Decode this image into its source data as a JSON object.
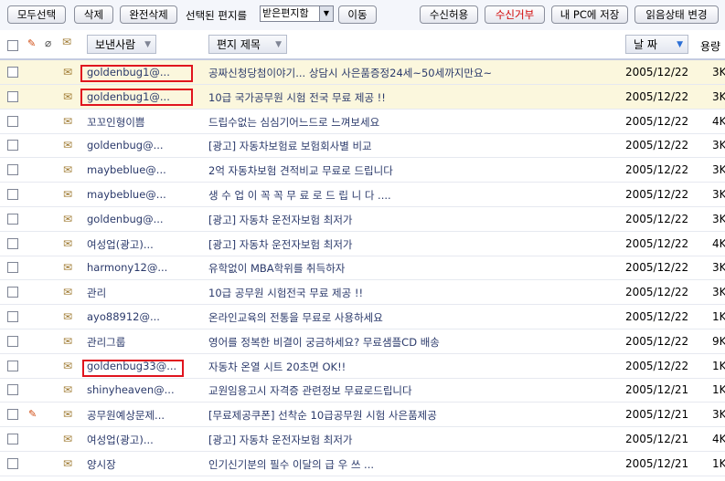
{
  "toolbar": {
    "select_all": "모두선택",
    "delete": "삭제",
    "delete_perm": "완전삭제",
    "move_label": "선택된 편지를",
    "folder": "받은편지함",
    "move": "이동",
    "allow": "수신허용",
    "reject": "수신거부",
    "save_pc": "내 PC에 저장",
    "read_status": "읽음상태 변경"
  },
  "columns": {
    "sender": "보낸사람",
    "subject": "편지 제목",
    "date": "날 짜",
    "size": "용량"
  },
  "rows": [
    {
      "sender": "goldenbug1@...",
      "subject": "공짜신청당첨이야기... 상담시 사은품증정24세~50세까지만요~",
      "date": "2005/12/22",
      "size": "3K"
    },
    {
      "sender": "goldenbug1@...",
      "subject": "10급 국가공무원 시험 전국 무료 제공 !!",
      "date": "2005/12/22",
      "size": "3K"
    },
    {
      "sender": "꼬꼬인형이쁨",
      "subject": "드립수없는 심심기어느드로 느껴보세요",
      "date": "2005/12/22",
      "size": "4K"
    },
    {
      "sender": "goldenbug@...",
      "subject": "[광고] 자동차보험료 보험회사별 비교",
      "date": "2005/12/22",
      "size": "3K"
    },
    {
      "sender": "maybeblue@...",
      "subject": "2억 자동차보험 견적비교 무료로 드립니다",
      "date": "2005/12/22",
      "size": "3K"
    },
    {
      "sender": "maybeblue@...",
      "subject": "생 수 업 이 꼭 꼭 무 료 로 드 립 니 다 ....",
      "date": "2005/12/22",
      "size": "3K"
    },
    {
      "sender": "goldenbug@...",
      "subject": "[광고] 자동차 운전자보험 최저가",
      "date": "2005/12/22",
      "size": "3K"
    },
    {
      "sender": "여성업(광고)...",
      "subject": "[광고] 자동차 운전자보험 최저가",
      "date": "2005/12/22",
      "size": "4K"
    },
    {
      "sender": "harmony12@...",
      "subject": "유학없이 MBA학위를 취득하자",
      "date": "2005/12/22",
      "size": "3K"
    },
    {
      "sender": "관리",
      "subject": "10급 공무원 시험전국 무료 제공 !!",
      "date": "2005/12/22",
      "size": "3K"
    },
    {
      "sender": "ayo88912@...",
      "subject": "온라인교육의 전통을 무료로 사용하세요",
      "date": "2005/12/22",
      "size": "1K"
    },
    {
      "sender": "관리그룹",
      "subject": "영어를 정복한 비결이 궁금하세요? 무료샘플CD 배송",
      "date": "2005/12/22",
      "size": "9K"
    },
    {
      "sender": "goldenbug33@...",
      "subject": "자동차 온열 시트 20초면 OK!!",
      "date": "2005/12/22",
      "size": "1K"
    },
    {
      "sender": "shinyheaven@...",
      "subject": "교원임용고시 자격증 관련정보 무료로드립니다",
      "date": "2005/12/21",
      "size": "1K"
    },
    {
      "sender": "공무원예상문제...",
      "subject": "[무료제공쿠폰] 선착순 10급공무원 시험 사은품제공",
      "date": "2005/12/21",
      "size": "3K"
    },
    {
      "sender": "여성업(광고)...",
      "subject": "[광고] 자동차 운전자보험 최저가",
      "date": "2005/12/21",
      "size": "4K"
    },
    {
      "sender": "양시장",
      "subject": "인기신기분의 필수 이달의 급 우 쓰 ...",
      "date": "2005/12/21",
      "size": "1K"
    }
  ],
  "colors": {
    "redbox": "#e0141e",
    "row_highlight": "#fbf7dd",
    "link": "#2b3a6b",
    "flag": "#d04a10"
  },
  "icons": [
    "checkbox-icon",
    "flag-icon",
    "attachment-icon",
    "envelope-icon",
    "sort-down-icon"
  ]
}
